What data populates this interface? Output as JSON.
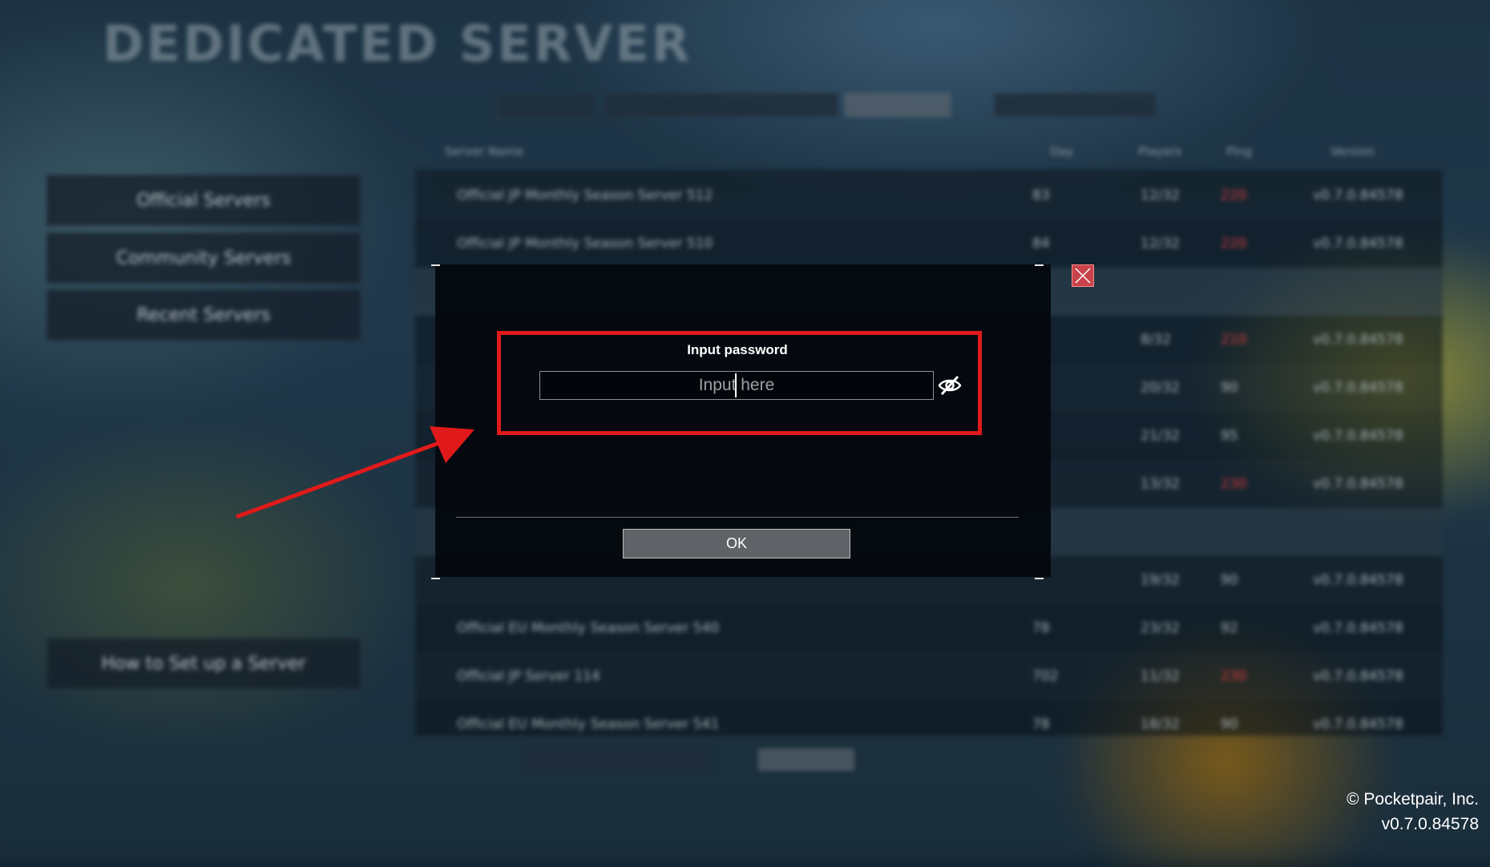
{
  "app": {
    "title": "DEDICATED SERVER"
  },
  "sidebar": {
    "items": [
      {
        "label": "Official Servers"
      },
      {
        "label": "Community Servers"
      },
      {
        "label": "Recent Servers"
      }
    ],
    "help_label": "How to Set up a Server"
  },
  "server_list": {
    "columns": [
      "Server Name",
      "Day",
      "Players",
      "Ping",
      "Version"
    ],
    "rows": [
      {
        "name": "Official JP Monthly Season Server 512",
        "day": "83",
        "players": "12/32",
        "ping": "220",
        "version": "v0.7.0.84578"
      },
      {
        "name": "Official JP Monthly Season Server 510",
        "day": "84",
        "players": "12/32",
        "ping": "220",
        "version": "v0.7.0.84578"
      },
      {
        "name": "",
        "day": "",
        "players": "",
        "ping": "",
        "version": ""
      },
      {
        "name": "",
        "day": "",
        "players": "8/32",
        "ping": "210",
        "version": "v0.7.0.84578"
      },
      {
        "name": "",
        "day": "",
        "players": "20/32",
        "ping": "90",
        "version": "v0.7.0.84578"
      },
      {
        "name": "",
        "day": "",
        "players": "21/32",
        "ping": "95",
        "version": "v0.7.0.84578"
      },
      {
        "name": "",
        "day": "",
        "players": "13/32",
        "ping": "230",
        "version": "v0.7.0.84578"
      },
      {
        "name": "",
        "day": "",
        "players": "",
        "ping": "",
        "version": ""
      },
      {
        "name": "",
        "day": "",
        "players": "19/32",
        "ping": "90",
        "version": "v0.7.0.84578"
      },
      {
        "name": "Official EU Monthly Season Server 540",
        "day": "78",
        "players": "23/32",
        "ping": "92",
        "version": "v0.7.0.84578"
      },
      {
        "name": "Official JP Server 114",
        "day": "702",
        "players": "11/32",
        "ping": "230",
        "version": "v0.7.0.84578"
      },
      {
        "name": "Official EU Monthly Season Server 541",
        "day": "78",
        "players": "18/32",
        "ping": "90",
        "version": "v0.7.0.84578"
      }
    ]
  },
  "dialog": {
    "label": "Input password",
    "input_placeholder": "Input here",
    "input_value": "",
    "ok_label": "OK"
  },
  "footer": {
    "copyright": "© Pocketpair, Inc.",
    "version": "v0.7.0.84578"
  },
  "colors": {
    "annotation_red": "#e01a1a",
    "close_button": "#c9434a",
    "ping_high": "#d83a3a"
  },
  "icons": {
    "close": "close-icon",
    "visibility": "eye-slash-icon"
  }
}
